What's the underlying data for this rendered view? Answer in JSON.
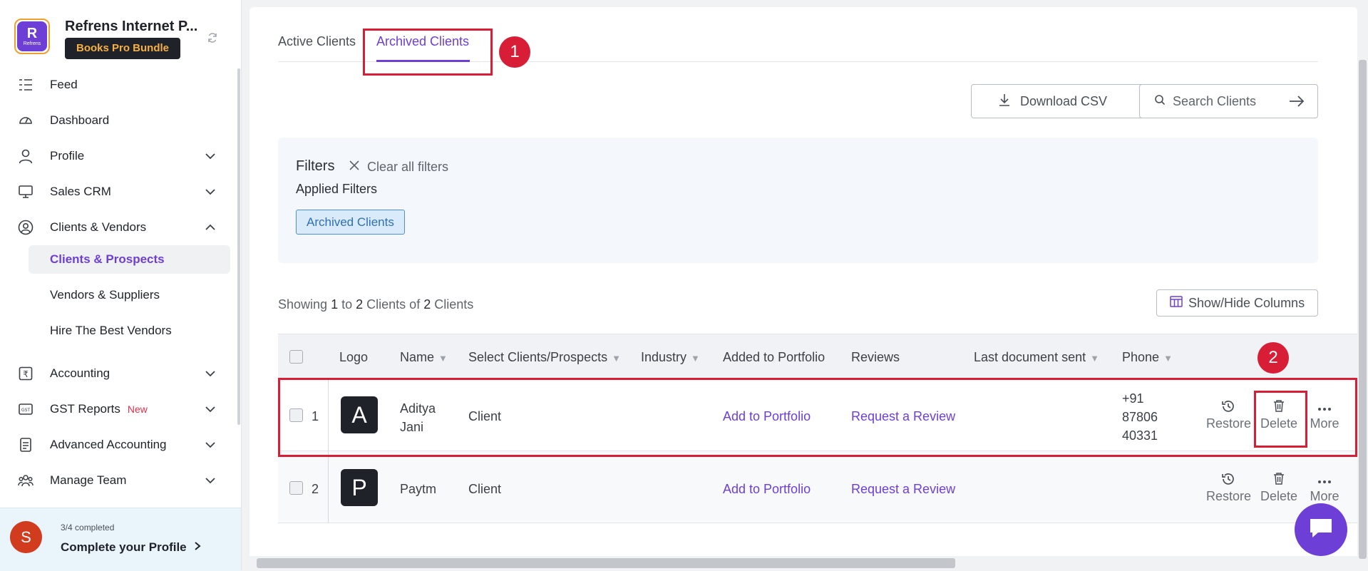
{
  "sidebar": {
    "logo_text": "Refrens",
    "business_name": "Refrens Internet P...",
    "plan_badge": "Books Pro Bundle",
    "nav": {
      "feed": "Feed",
      "dashboard": "Dashboard",
      "profile": "Profile",
      "sales_crm": "Sales CRM",
      "clients_vendors": "Clients & Vendors",
      "clients_prospects": "Clients & Prospects",
      "vendors_suppliers": "Vendors & Suppliers",
      "hire_vendors": "Hire The Best Vendors",
      "accounting": "Accounting",
      "gst_reports": "GST Reports",
      "gst_new": "New",
      "advanced_accounting": "Advanced Accounting",
      "manage_team": "Manage Team"
    },
    "profile_card": {
      "avatar_letter": "S",
      "progress": "3/4 completed",
      "cta": "Complete your Profile"
    }
  },
  "tabs": {
    "active": "Active Clients",
    "archived": "Archived Clients"
  },
  "annotations": {
    "one": "1",
    "two": "2"
  },
  "toolbar": {
    "download_csv": "Download CSV",
    "search_placeholder": "Search Clients"
  },
  "filters": {
    "title": "Filters",
    "clear": "Clear all filters",
    "applied_label": "Applied Filters",
    "chip": "Archived Clients"
  },
  "summary": {
    "showing": "Showing",
    "from": "1",
    "to_word": "to",
    "to": "2",
    "clients_word": "Clients of",
    "total": "2",
    "tail": "Clients"
  },
  "show_hide_columns": "Show/Hide Columns",
  "table": {
    "headers": {
      "logo": "Logo",
      "name": "Name",
      "select": "Select Clients/Prospects",
      "industry": "Industry",
      "added": "Added to Portfolio",
      "reviews": "Reviews",
      "last_doc": "Last document sent",
      "phone": "Phone"
    },
    "rows": [
      {
        "index": "1",
        "logo_letter": "A",
        "name_line1": "Aditya",
        "name_line2": "Jani",
        "type": "Client",
        "portfolio": "Add to Portfolio",
        "review": "Request a Review",
        "phone_line1": "+91",
        "phone_line2": "87806",
        "phone_line3": "40331",
        "restore": "Restore",
        "delete": "Delete",
        "more": "More"
      },
      {
        "index": "2",
        "logo_letter": "P",
        "name_line1": "Paytm",
        "type": "Client",
        "portfolio": "Add to Portfolio",
        "review": "Request a Review",
        "restore": "Restore",
        "delete": "Delete",
        "more": "More"
      }
    ]
  },
  "colors": {
    "accent": "#6d3fd7",
    "annotation_red": "#d81e36",
    "badge_bg": "#1f2329",
    "badge_text": "#f6b042"
  }
}
